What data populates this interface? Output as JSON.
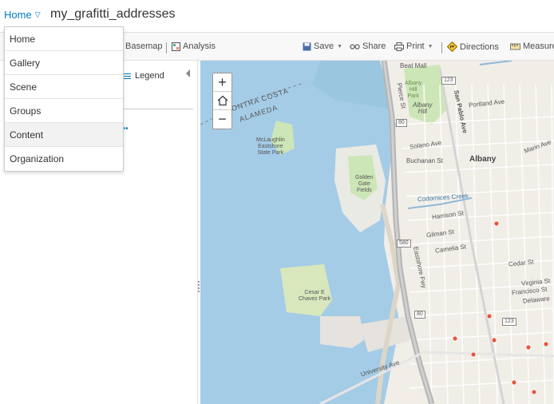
{
  "header": {
    "home_label": "Home",
    "map_title": "my_grafitti_addresses"
  },
  "menu": {
    "items": [
      "Home",
      "Gallery",
      "Scene",
      "Groups",
      "Content",
      "Organization"
    ],
    "active_index": 4
  },
  "toolbar": {
    "basemap_label": "Basemap",
    "analysis_label": "Analysis",
    "save_label": "Save",
    "share_label": "Share",
    "print_label": "Print",
    "directions_label": "Directions",
    "measure_label": "Measure"
  },
  "left_pane": {
    "legend_label": "Legend",
    "dots": "•••"
  },
  "map": {
    "labels": {
      "contra_costa": "CONTRA COSTA",
      "alameda": "ALAMEDA",
      "mclaughlin": "McLaughlin\nEastshore\nState Park",
      "golden_gate": "Golden\nGate\nFields",
      "cesar_chavez": "Cesar E\nChavez Park",
      "albany_park": "Albany\nHill\nPark",
      "albany_hill": "Albany\nHill",
      "albany": "Albany",
      "codornices": "Codornices Creek",
      "university": "University Ave",
      "buchanan": "Buchanan St",
      "solano": "Solano Ave",
      "portland": "Portland Ave",
      "harrison": "Harrison St",
      "gilman": "Gilman St",
      "camelia": "Camelia St",
      "cedar": "Cedar St",
      "virginia": "Virginia St",
      "francisco": "Francisco St",
      "delaware": "Delaware",
      "marin": "Marin Ave",
      "eastshore": "Eastshore Fwy",
      "san_pablo": "San Pablo Ave",
      "pierce": "Pierce St",
      "beat_mall": "Beat Mall",
      "route_123": "123",
      "route_580": "580",
      "route_80": "80"
    },
    "colors": {
      "water": "#a5cce6",
      "land": "#f1eee8",
      "park": "#cde6b8",
      "highway": "#b5b5b5",
      "points": "#e8553f"
    },
    "grafitti_point_count": 9
  },
  "zoom": {
    "in": "+",
    "out": "−"
  }
}
